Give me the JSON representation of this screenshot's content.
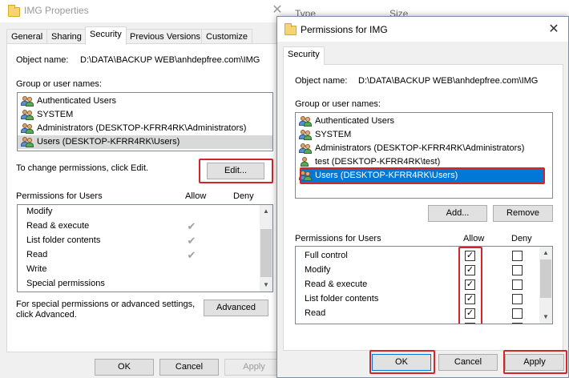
{
  "explorer": {
    "col_type": "Type",
    "col_size": "Size"
  },
  "props": {
    "title": "IMG Properties",
    "tabs": [
      "General",
      "Sharing",
      "Security",
      "Previous Versions",
      "Customize"
    ],
    "object_name_label": "Object name:",
    "object_name_value": "D:\\DATA\\BACKUP WEB\\anhdepfree.com\\IMG",
    "group_label": "Group or user names:",
    "users": [
      "Authenticated Users",
      "SYSTEM",
      "Administrators (DESKTOP-KFRR4RK\\Administrators)",
      "Users (DESKTOP-KFRR4RK\\Users)"
    ],
    "change_text": "To change permissions, click Edit.",
    "edit_label": "Edit...",
    "perm_header": "Permissions for Users",
    "allow_header": "Allow",
    "deny_header": "Deny",
    "permissions": [
      {
        "name": "Modify",
        "allow": false
      },
      {
        "name": "Read & execute",
        "allow": true
      },
      {
        "name": "List folder contents",
        "allow": true
      },
      {
        "name": "Read",
        "allow": true
      },
      {
        "name": "Write",
        "allow": false
      },
      {
        "name": "Special permissions",
        "allow": false
      }
    ],
    "special_text_1": "For special permissions or advanced settings,",
    "special_text_2": "click Advanced.",
    "advanced_label": "Advanced",
    "ok_label": "OK",
    "cancel_label": "Cancel",
    "apply_label": "Apply"
  },
  "perm": {
    "title": "Permissions for IMG",
    "tab": "Security",
    "object_name_label": "Object name:",
    "object_name_value": "D:\\DATA\\BACKUP WEB\\anhdepfree.com\\IMG",
    "group_label": "Group or user names:",
    "users": [
      "Authenticated Users",
      "SYSTEM",
      "Administrators (DESKTOP-KFRR4RK\\Administrators)",
      "test (DESKTOP-KFRR4RK\\test)",
      "Users (DESKTOP-KFRR4RK\\Users)"
    ],
    "add_label": "Add...",
    "remove_label": "Remove",
    "perm_header": "Permissions for Users",
    "allow_header": "Allow",
    "deny_header": "Deny",
    "permissions": [
      {
        "name": "Full control",
        "allow": true,
        "deny": false
      },
      {
        "name": "Modify",
        "allow": true,
        "deny": false
      },
      {
        "name": "Read & execute",
        "allow": true,
        "deny": false
      },
      {
        "name": "List folder contents",
        "allow": true,
        "deny": false
      },
      {
        "name": "Read",
        "allow": true,
        "deny": false
      }
    ],
    "ok_label": "OK",
    "cancel_label": "Cancel",
    "apply_label": "Apply"
  },
  "colors": {
    "accent": "#0078d7",
    "highlight_box": "#d3262b"
  }
}
